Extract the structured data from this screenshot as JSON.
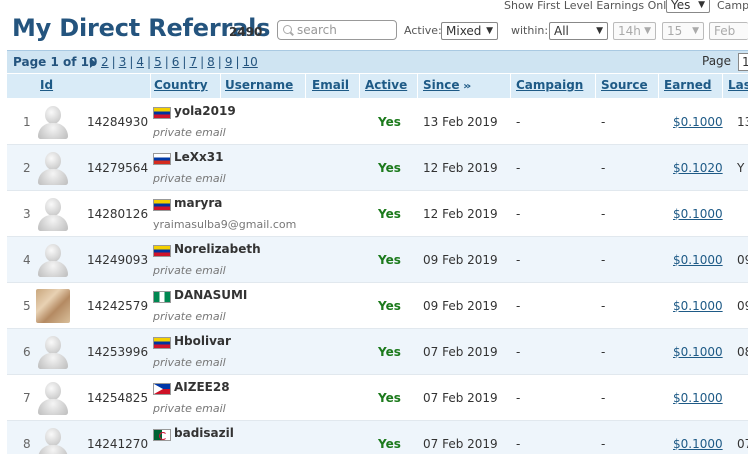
{
  "header": {
    "title": "My Direct Referrals",
    "count": "2490",
    "search_placeholder": "search",
    "show_first_label": "Show First Level Earnings Only:",
    "show_first_value": "Yes",
    "camp_label": "Camp",
    "active_label": "Active:",
    "active_value": "Mixed",
    "within_label": "within:",
    "within_value": "All",
    "hour_value": "14h",
    "minute_value": "15",
    "month_value": "Feb"
  },
  "pager": {
    "label": "Page 1 of 10",
    "pages": [
      "2",
      "3",
      "4",
      "5",
      "6",
      "7",
      "8",
      "9",
      "10"
    ],
    "page_label": "Page",
    "page_value": "1"
  },
  "columns": [
    "Id",
    "Country",
    "Username",
    "Email",
    "Active",
    "Since",
    "Campaign",
    "Source",
    "Earned",
    "Las"
  ],
  "rows": [
    {
      "n": "1",
      "id": "14284930",
      "flag": "ve",
      "username": "yola2019",
      "email": "private email",
      "active": "Yes",
      "since": "13 Feb 2019",
      "campaign": "-",
      "source": "-",
      "earned": "$0.1000",
      "last": "13",
      "photo": false
    },
    {
      "n": "2",
      "id": "14279564",
      "flag": "ru",
      "username": "LeXx31",
      "email": "private email",
      "active": "Yes",
      "since": "12 Feb 2019",
      "campaign": "-",
      "source": "-",
      "earned": "$0.1020",
      "last": "Y",
      "photo": false
    },
    {
      "n": "3",
      "id": "14280126",
      "flag": "ve",
      "username": "maryra",
      "email": "yraimasulba9@gmail.com",
      "active": "Yes",
      "since": "12 Feb 2019",
      "campaign": "-",
      "source": "-",
      "earned": "$0.1000",
      "last": "",
      "photo": false
    },
    {
      "n": "4",
      "id": "14249093",
      "flag": "ve",
      "username": "Norelizabeth",
      "email": "private email",
      "active": "Yes",
      "since": "09 Feb 2019",
      "campaign": "-",
      "source": "-",
      "earned": "$0.1000",
      "last": "09",
      "photo": false
    },
    {
      "n": "5",
      "id": "14242579",
      "flag": "ng",
      "username": "DANASUMI",
      "email": "private email",
      "active": "Yes",
      "since": "09 Feb 2019",
      "campaign": "-",
      "source": "-",
      "earned": "$0.1000",
      "last": "09",
      "photo": true
    },
    {
      "n": "6",
      "id": "14253996",
      "flag": "ve",
      "username": "Hbolivar",
      "email": "private email",
      "active": "Yes",
      "since": "07 Feb 2019",
      "campaign": "-",
      "source": "-",
      "earned": "$0.1000",
      "last": "08",
      "photo": false
    },
    {
      "n": "7",
      "id": "14254825",
      "flag": "ph",
      "username": "AIZEE28",
      "email": "private email",
      "active": "Yes",
      "since": "07 Feb 2019",
      "campaign": "-",
      "source": "-",
      "earned": "$0.1000",
      "last": "",
      "photo": false
    },
    {
      "n": "8",
      "id": "14241270",
      "flag": "dz",
      "username": "badisazil",
      "email": "",
      "active": "Yes",
      "since": "07 Feb 2019",
      "campaign": "-",
      "source": "-",
      "earned": "$0.1000",
      "last": "07",
      "photo": false
    }
  ]
}
